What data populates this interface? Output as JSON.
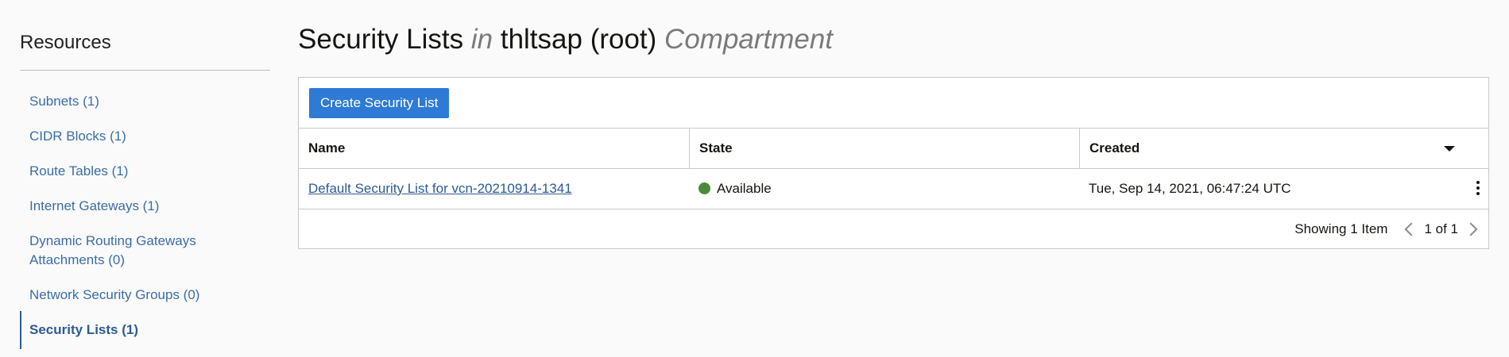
{
  "sidebar": {
    "title": "Resources",
    "items": [
      {
        "label": "Subnets (1)"
      },
      {
        "label": "CIDR Blocks (1)"
      },
      {
        "label": "Route Tables (1)"
      },
      {
        "label": "Internet Gateways (1)"
      },
      {
        "label": "Dynamic Routing Gateways Attachments (0)"
      },
      {
        "label": "Network Security Groups (0)"
      },
      {
        "label": "Security Lists (1)",
        "active": true
      }
    ]
  },
  "header": {
    "title_prefix": "Security Lists",
    "title_in": "in",
    "title_compartment": "thltsap (root)",
    "title_suffix": "Compartment"
  },
  "toolbar": {
    "create_label": "Create Security List"
  },
  "table": {
    "columns": [
      "Name",
      "State",
      "Created"
    ],
    "rows": [
      {
        "name": "Default Security List for vcn-20210914-1341",
        "state": "Available",
        "created": "Tue, Sep 14, 2021, 06:47:24 UTC"
      }
    ]
  },
  "pager": {
    "showing": "Showing 1 Item",
    "pages": "1 of 1"
  },
  "colors": {
    "accent": "#2e7ad4",
    "link": "#2c5b93",
    "status_available": "#4b8a3c"
  }
}
